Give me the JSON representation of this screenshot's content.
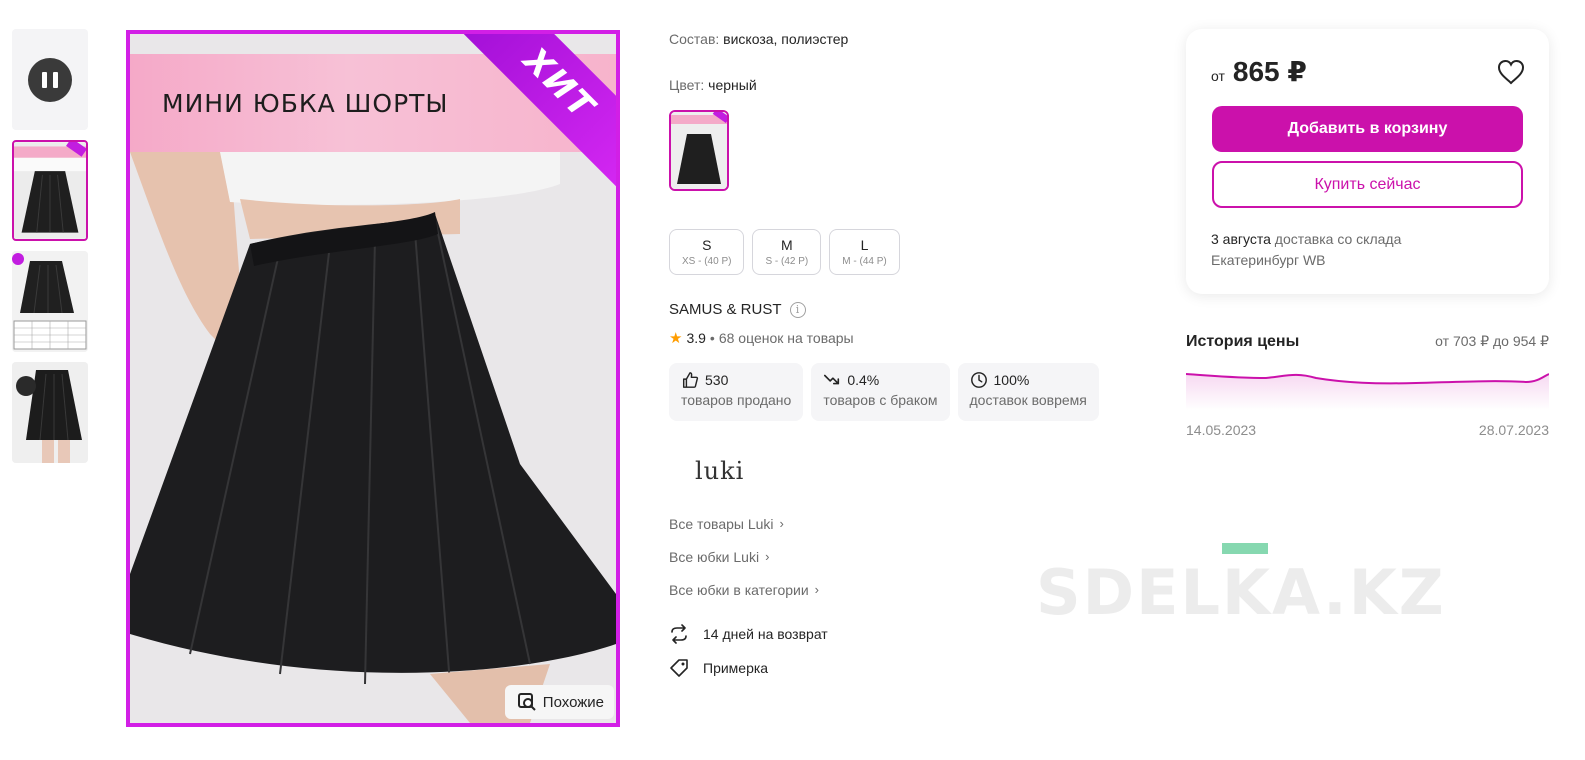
{
  "gallery": {
    "main_banner_title": "МИНИ ЮБКА ШОРТЫ",
    "hit_label": "ХИТ",
    "similar_label": "Похожие",
    "thumbnails": [
      "video",
      "photo-1",
      "photo-2",
      "photo-3"
    ]
  },
  "details": {
    "composition_label": "Состав:",
    "composition_value": "вискоза, полиэстер",
    "color_label": "Цвет:",
    "color_value": "черный",
    "sizes": [
      {
        "size": "S",
        "ru": "XS - (40 Р)"
      },
      {
        "size": "M",
        "ru": "S - (42 Р)"
      },
      {
        "size": "L",
        "ru": "M - (44 Р)"
      }
    ],
    "brand": "SAMUS & RUST",
    "rating": "3.9",
    "rating_separator": "•",
    "reviews": "68 оценок на товары",
    "stats": [
      {
        "value": "530",
        "label": "товаров продано",
        "icon": "thumb-up-icon"
      },
      {
        "value": "0.4%",
        "label": "товаров с браком",
        "icon": "trend-down-icon"
      },
      {
        "value": "100%",
        "label": "доставок вовремя",
        "icon": "clock-icon"
      }
    ],
    "store_logo": "luki",
    "links": [
      "Все товары Luki",
      "Все юбки Luki",
      "Все юбки в категории"
    ],
    "features": [
      {
        "label": "14 дней на возврат",
        "icon": "return-icon"
      },
      {
        "label": "Примерка",
        "icon": "tag-icon"
      }
    ]
  },
  "price_card": {
    "from_label": "от",
    "price": "865 ₽",
    "add_to_cart": "Добавить в корзину",
    "buy_now": "Купить сейчас",
    "delivery_date": "3 августа",
    "delivery_text": "доставка со склада",
    "delivery_city": "Екатеринбург WB"
  },
  "price_history": {
    "title": "История цены",
    "range_text": "от 703 ₽ до 954 ₽",
    "start_date": "14.05.2023",
    "end_date": "28.07.2023",
    "line_color": "#cb11ab"
  },
  "watermark": "SDELKA.KZ",
  "colors": {
    "accent": "#cb11ab",
    "image_border": "#d21fe6"
  }
}
